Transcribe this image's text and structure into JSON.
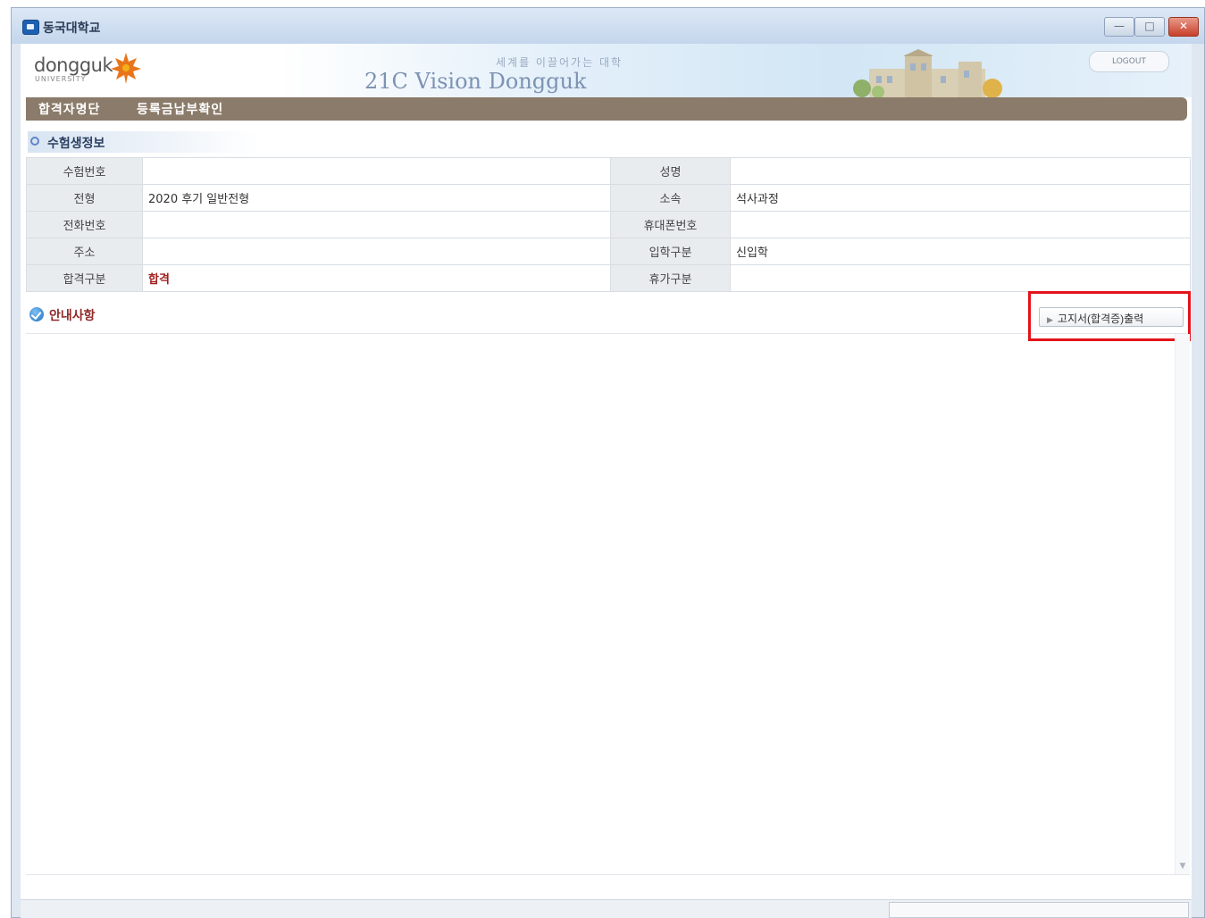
{
  "window": {
    "title": "동국대학교",
    "controls": {
      "minimize": "—",
      "maximize": "□",
      "close": "✕"
    }
  },
  "header": {
    "logo": "dongguk",
    "logo_sub": "UNIVERSITY",
    "vision": "21C Vision Dongguk",
    "vision_ko": "세계를 이끌어가는 대학",
    "logout": "LOGOUT"
  },
  "menu": {
    "items": [
      "합격자명단",
      "등록금납부확인"
    ]
  },
  "section": {
    "title": "수험생정보"
  },
  "table": {
    "rows": [
      {
        "label_left": "수험번호",
        "value_left": "",
        "label_right": "성명",
        "value_right": ""
      },
      {
        "label_left": "전형",
        "value_left": "2020 후기 일반전형",
        "label_right": "소속",
        "value_right": "석사과정"
      },
      {
        "label_left": "전화번호",
        "value_left": "",
        "label_right": "휴대폰번호",
        "value_right": ""
      },
      {
        "label_left": "주소",
        "value_left": "",
        "label_right": "입학구분",
        "value_right": "신입학"
      },
      {
        "label_left": "합격구분",
        "value_left": "합격",
        "label_right": "휴가구분",
        "value_right": ""
      }
    ]
  },
  "notice": {
    "title": "안내사항",
    "print_button": "고지서(합격증)출력"
  },
  "colors": {
    "menubar": "#8b7b6a",
    "highlight": "#e3131b",
    "pass": "#a11f1f"
  },
  "icons": {
    "app": "app-icon",
    "section": "circle-bullet-icon",
    "notice": "check-globe-icon",
    "print_arrow": "arrow-right-icon"
  }
}
